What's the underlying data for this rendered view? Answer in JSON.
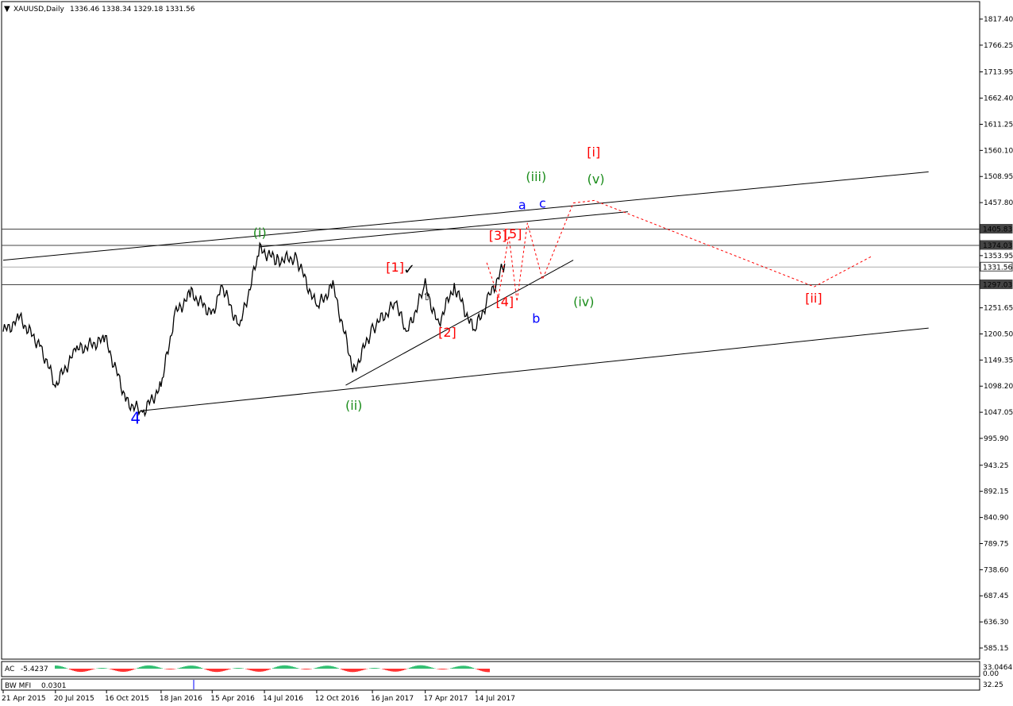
{
  "header": {
    "symbol": "XAUUSD,Daily",
    "ohlc": "1336.46 1338.34 1329.18 1331.56"
  },
  "chart_data": {
    "type": "line",
    "title": "XAUUSD,Daily",
    "ylim": [
      585.15,
      1817.4
    ],
    "y_ticks": [
      "1817.40",
      "1766.25",
      "1713.95",
      "1662.40",
      "1611.25",
      "1560.10",
      "1508.95",
      "1457.80",
      "1353.95",
      "1251.65",
      "1200.50",
      "1149.35",
      "1098.20",
      "1047.05",
      "995.90",
      "943.25",
      "892.15",
      "840.90",
      "789.75",
      "738.60",
      "687.45",
      "636.30",
      "585.15"
    ],
    "x_ticks": [
      "21 Apr 2015",
      "20 Jul 2015",
      "16 Oct 2015",
      "18 Jan 2016",
      "15 Apr 2016",
      "14 Jul 2016",
      "12 Oct 2016",
      "16 Jan 2017",
      "17 Apr 2017",
      "14 Jul 2017"
    ],
    "price_series": {
      "name": "XAUUSD",
      "x": [
        "2015-04-21",
        "2015-05-20",
        "2015-06-25",
        "2015-07-20",
        "2015-08-24",
        "2015-10-14",
        "2015-11-20",
        "2015-12-17",
        "2016-01-18",
        "2016-02-11",
        "2016-03-10",
        "2016-04-15",
        "2016-05-02",
        "2016-06-01",
        "2016-07-06",
        "2016-08-05",
        "2016-09-07",
        "2016-10-12",
        "2016-11-09",
        "2016-12-15",
        "2017-01-16",
        "2017-02-27",
        "2017-03-15",
        "2017-04-17",
        "2017-05-09",
        "2017-06-06",
        "2017-07-10",
        "2017-08-04",
        "2017-09-01"
      ],
      "y": [
        1205,
        1230,
        1175,
        1100,
        1168,
        1190,
        1068,
        1046,
        1098,
        1240,
        1280,
        1240,
        1295,
        1212,
        1366,
        1345,
        1350,
        1252,
        1295,
        1126,
        1212,
        1262,
        1198,
        1295,
        1218,
        1296,
        1205,
        1270,
        1338
      ]
    },
    "price_labels": [
      {
        "value": "1405.83",
        "y": 1405.83
      },
      {
        "value": "1374.03",
        "y": 1374.03
      },
      {
        "value": "1331.56",
        "y": 1331.56
      },
      {
        "value": "1297.03",
        "y": 1297.03
      }
    ],
    "wave_labels": [
      {
        "text": "4",
        "color": "#0000ff",
        "x": "2015-12-05",
        "y": 1025
      },
      {
        "text": "(i)",
        "color": "#1a8c1a",
        "x": "2016-07-06",
        "y": 1390
      },
      {
        "text": "(ii)",
        "color": "#1a8c1a",
        "x": "2016-12-15",
        "y": 1052
      },
      {
        "text": "(iii)",
        "color": "#1a8c1a",
        "x": "2017-10-25",
        "y": 1500
      },
      {
        "text": "(iv)",
        "color": "#1a8c1a",
        "x": "2018-01-15",
        "y": 1255
      },
      {
        "text": "(v)",
        "color": "#1a8c1a",
        "x": "2018-02-05",
        "y": 1495
      },
      {
        "text": "a",
        "color": "#0000ff",
        "x": "2017-10-01",
        "y": 1445
      },
      {
        "text": "b",
        "color": "#0000ff",
        "x": "2017-10-25",
        "y": 1222
      },
      {
        "text": "c",
        "color": "#0000ff",
        "x": "2017-11-05",
        "y": 1448
      },
      {
        "text": "[1]",
        "color": "#ff0000",
        "x": "2017-02-24",
        "y": 1323
      },
      {
        "text": "[2]",
        "color": "#ff0000",
        "x": "2017-05-25",
        "y": 1195
      },
      {
        "text": "[3]",
        "color": "#ff0000",
        "x": "2017-08-20",
        "y": 1385
      },
      {
        "text": "[4]",
        "color": "#ff0000",
        "x": "2017-09-01",
        "y": 1255
      },
      {
        "text": "[5]",
        "color": "#ff0000",
        "x": "2017-09-15",
        "y": 1388
      },
      {
        "text": "[i]",
        "color": "#ff0000",
        "x": "2018-02-01",
        "y": 1548
      },
      {
        "text": "[ii]",
        "color": "#ff0000",
        "x": "2019-02-15",
        "y": 1262
      }
    ],
    "projection": {
      "style": "dashed",
      "color": "#ff0000",
      "x": [
        "2017-08-01",
        "2017-08-21",
        "2017-09-08",
        "2017-09-22",
        "2017-10-10",
        "2017-11-05",
        "2017-12-28",
        "2018-02-02",
        "2019-02-16",
        "2019-05-25"
      ],
      "y": [
        1340,
        1272,
        1393,
        1264,
        1418,
        1307,
        1457,
        1462,
        1293,
        1352
      ]
    },
    "trendlines": [
      {
        "color": "#000000",
        "x": [
          "2015-04-21",
          "2019-09-01"
        ],
        "y": [
          1345,
          1518
        ]
      },
      {
        "color": "#000000",
        "x": [
          "2016-07-06",
          "2018-04-01"
        ],
        "y": [
          1371,
          1440
        ]
      },
      {
        "color": "#000000",
        "x": [
          "2016-12-01",
          "2017-12-28"
        ],
        "y": [
          1100,
          1345
        ]
      },
      {
        "color": "#000000",
        "x": [
          "2015-12-15",
          "2019-09-01"
        ],
        "y": [
          1050,
          1212
        ]
      }
    ],
    "indicators": [
      {
        "name": "AC",
        "value": "-5.4237",
        "scale": "33.0464",
        "scale2": "0.00"
      },
      {
        "name": "BW MFI",
        "value": "0.0301",
        "scale": "32.25"
      }
    ],
    "colors": {
      "up": "#00b050",
      "down": "#ff0000",
      "price_line": "#000000",
      "grid": "#888888"
    }
  }
}
